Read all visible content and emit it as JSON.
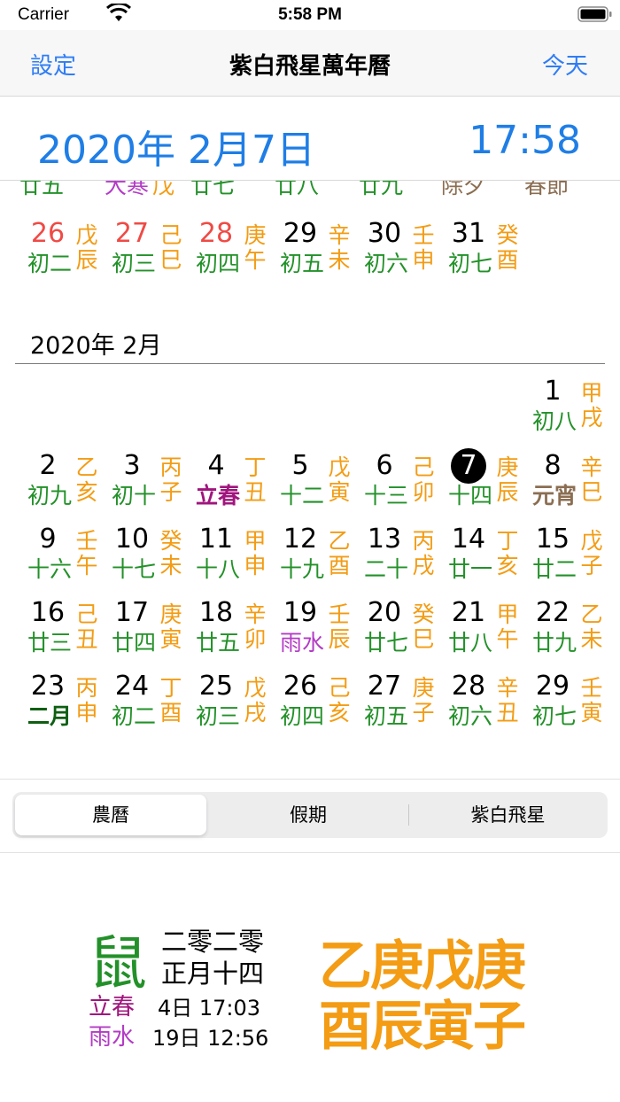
{
  "status_bar": {
    "carrier": "Carrier",
    "time": "5:58 PM"
  },
  "nav": {
    "left": "設定",
    "title": "紫白飛星萬年曆",
    "right": "今天"
  },
  "current": {
    "date": "2020年 2月7日",
    "time": "17:58"
  },
  "top_strip": [
    "廿五",
    "大寒",
    "戊",
    "廿七",
    "廿八",
    "廿九",
    "除夕",
    "春節"
  ],
  "jan_row": [
    {
      "day": "26",
      "lunar": "初二",
      "gz": [
        "戊",
        "辰"
      ],
      "red": true
    },
    {
      "day": "27",
      "lunar": "初三",
      "gz": [
        "己",
        "巳"
      ],
      "red": true
    },
    {
      "day": "28",
      "lunar": "初四",
      "gz": [
        "庚",
        "午"
      ],
      "red": true
    },
    {
      "day": "29",
      "lunar": "初五",
      "gz": [
        "辛",
        "未"
      ]
    },
    {
      "day": "30",
      "lunar": "初六",
      "gz": [
        "壬",
        "申"
      ]
    },
    {
      "day": "31",
      "lunar": "初七",
      "gz": [
        "癸",
        "酉"
      ]
    }
  ],
  "month_header": "2020年 2月",
  "feb": [
    [
      null,
      null,
      null,
      null,
      null,
      null,
      {
        "day": "1",
        "lunar": "初八",
        "gz": [
          "甲",
          "戌"
        ]
      }
    ],
    [
      {
        "day": "2",
        "lunar": "初九",
        "gz": [
          "乙",
          "亥"
        ]
      },
      {
        "day": "3",
        "lunar": "初十",
        "gz": [
          "丙",
          "子"
        ]
      },
      {
        "day": "4",
        "lunar": "立春",
        "gz": [
          "丁",
          "丑"
        ],
        "kind": "term"
      },
      {
        "day": "5",
        "lunar": "十二",
        "gz": [
          "戊",
          "寅"
        ]
      },
      {
        "day": "6",
        "lunar": "十三",
        "gz": [
          "己",
          "卯"
        ]
      },
      {
        "day": "7",
        "lunar": "十四",
        "gz": [
          "庚",
          "辰"
        ],
        "selected": true
      },
      {
        "day": "8",
        "lunar": "元宵",
        "gz": [
          "辛",
          "巳"
        ],
        "kind": "fest"
      }
    ],
    [
      {
        "day": "9",
        "lunar": "十六",
        "gz": [
          "壬",
          "午"
        ]
      },
      {
        "day": "10",
        "lunar": "十七",
        "gz": [
          "癸",
          "未"
        ]
      },
      {
        "day": "11",
        "lunar": "十八",
        "gz": [
          "甲",
          "申"
        ]
      },
      {
        "day": "12",
        "lunar": "十九",
        "gz": [
          "乙",
          "酉"
        ]
      },
      {
        "day": "13",
        "lunar": "二十",
        "gz": [
          "丙",
          "戌"
        ]
      },
      {
        "day": "14",
        "lunar": "廿一",
        "gz": [
          "丁",
          "亥"
        ]
      },
      {
        "day": "15",
        "lunar": "廿二",
        "gz": [
          "戊",
          "子"
        ]
      }
    ],
    [
      {
        "day": "16",
        "lunar": "廿三",
        "gz": [
          "己",
          "丑"
        ]
      },
      {
        "day": "17",
        "lunar": "廿四",
        "gz": [
          "庚",
          "寅"
        ]
      },
      {
        "day": "18",
        "lunar": "廿五",
        "gz": [
          "辛",
          "卯"
        ]
      },
      {
        "day": "19",
        "lunar": "雨水",
        "gz": [
          "壬",
          "辰"
        ],
        "kind": "rain"
      },
      {
        "day": "20",
        "lunar": "廿七",
        "gz": [
          "癸",
          "巳"
        ]
      },
      {
        "day": "21",
        "lunar": "廿八",
        "gz": [
          "甲",
          "午"
        ]
      },
      {
        "day": "22",
        "lunar": "廿九",
        "gz": [
          "乙",
          "未"
        ]
      }
    ],
    [
      {
        "day": "23",
        "lunar": "二月",
        "gz": [
          "丙",
          "申"
        ],
        "kind": "month"
      },
      {
        "day": "24",
        "lunar": "初二",
        "gz": [
          "丁",
          "酉"
        ]
      },
      {
        "day": "25",
        "lunar": "初三",
        "gz": [
          "戊",
          "戌"
        ]
      },
      {
        "day": "26",
        "lunar": "初四",
        "gz": [
          "己",
          "亥"
        ]
      },
      {
        "day": "27",
        "lunar": "初五",
        "gz": [
          "庚",
          "子"
        ]
      },
      {
        "day": "28",
        "lunar": "初六",
        "gz": [
          "辛",
          "丑"
        ]
      },
      {
        "day": "29",
        "lunar": "初七",
        "gz": [
          "壬",
          "寅"
        ]
      }
    ]
  ],
  "segments": {
    "items": [
      "農曆",
      "假期",
      "紫白飛星"
    ],
    "selected": "農曆"
  },
  "info": {
    "zodiac": "鼠",
    "lunar_year": "二零二零",
    "lunar_date": "正月十四",
    "term1_name": "立春",
    "term1_value": "4日 17:03",
    "term2_name": "雨水",
    "term2_value": "19日 12:56",
    "bazi_stems": "乙庚戊庚",
    "bazi_branches": "酉辰寅子"
  },
  "colors": {
    "accent": "#1f7ee6",
    "ganzhi": "#f39c14",
    "lunar": "#239129",
    "weekend": "#f04a45"
  }
}
